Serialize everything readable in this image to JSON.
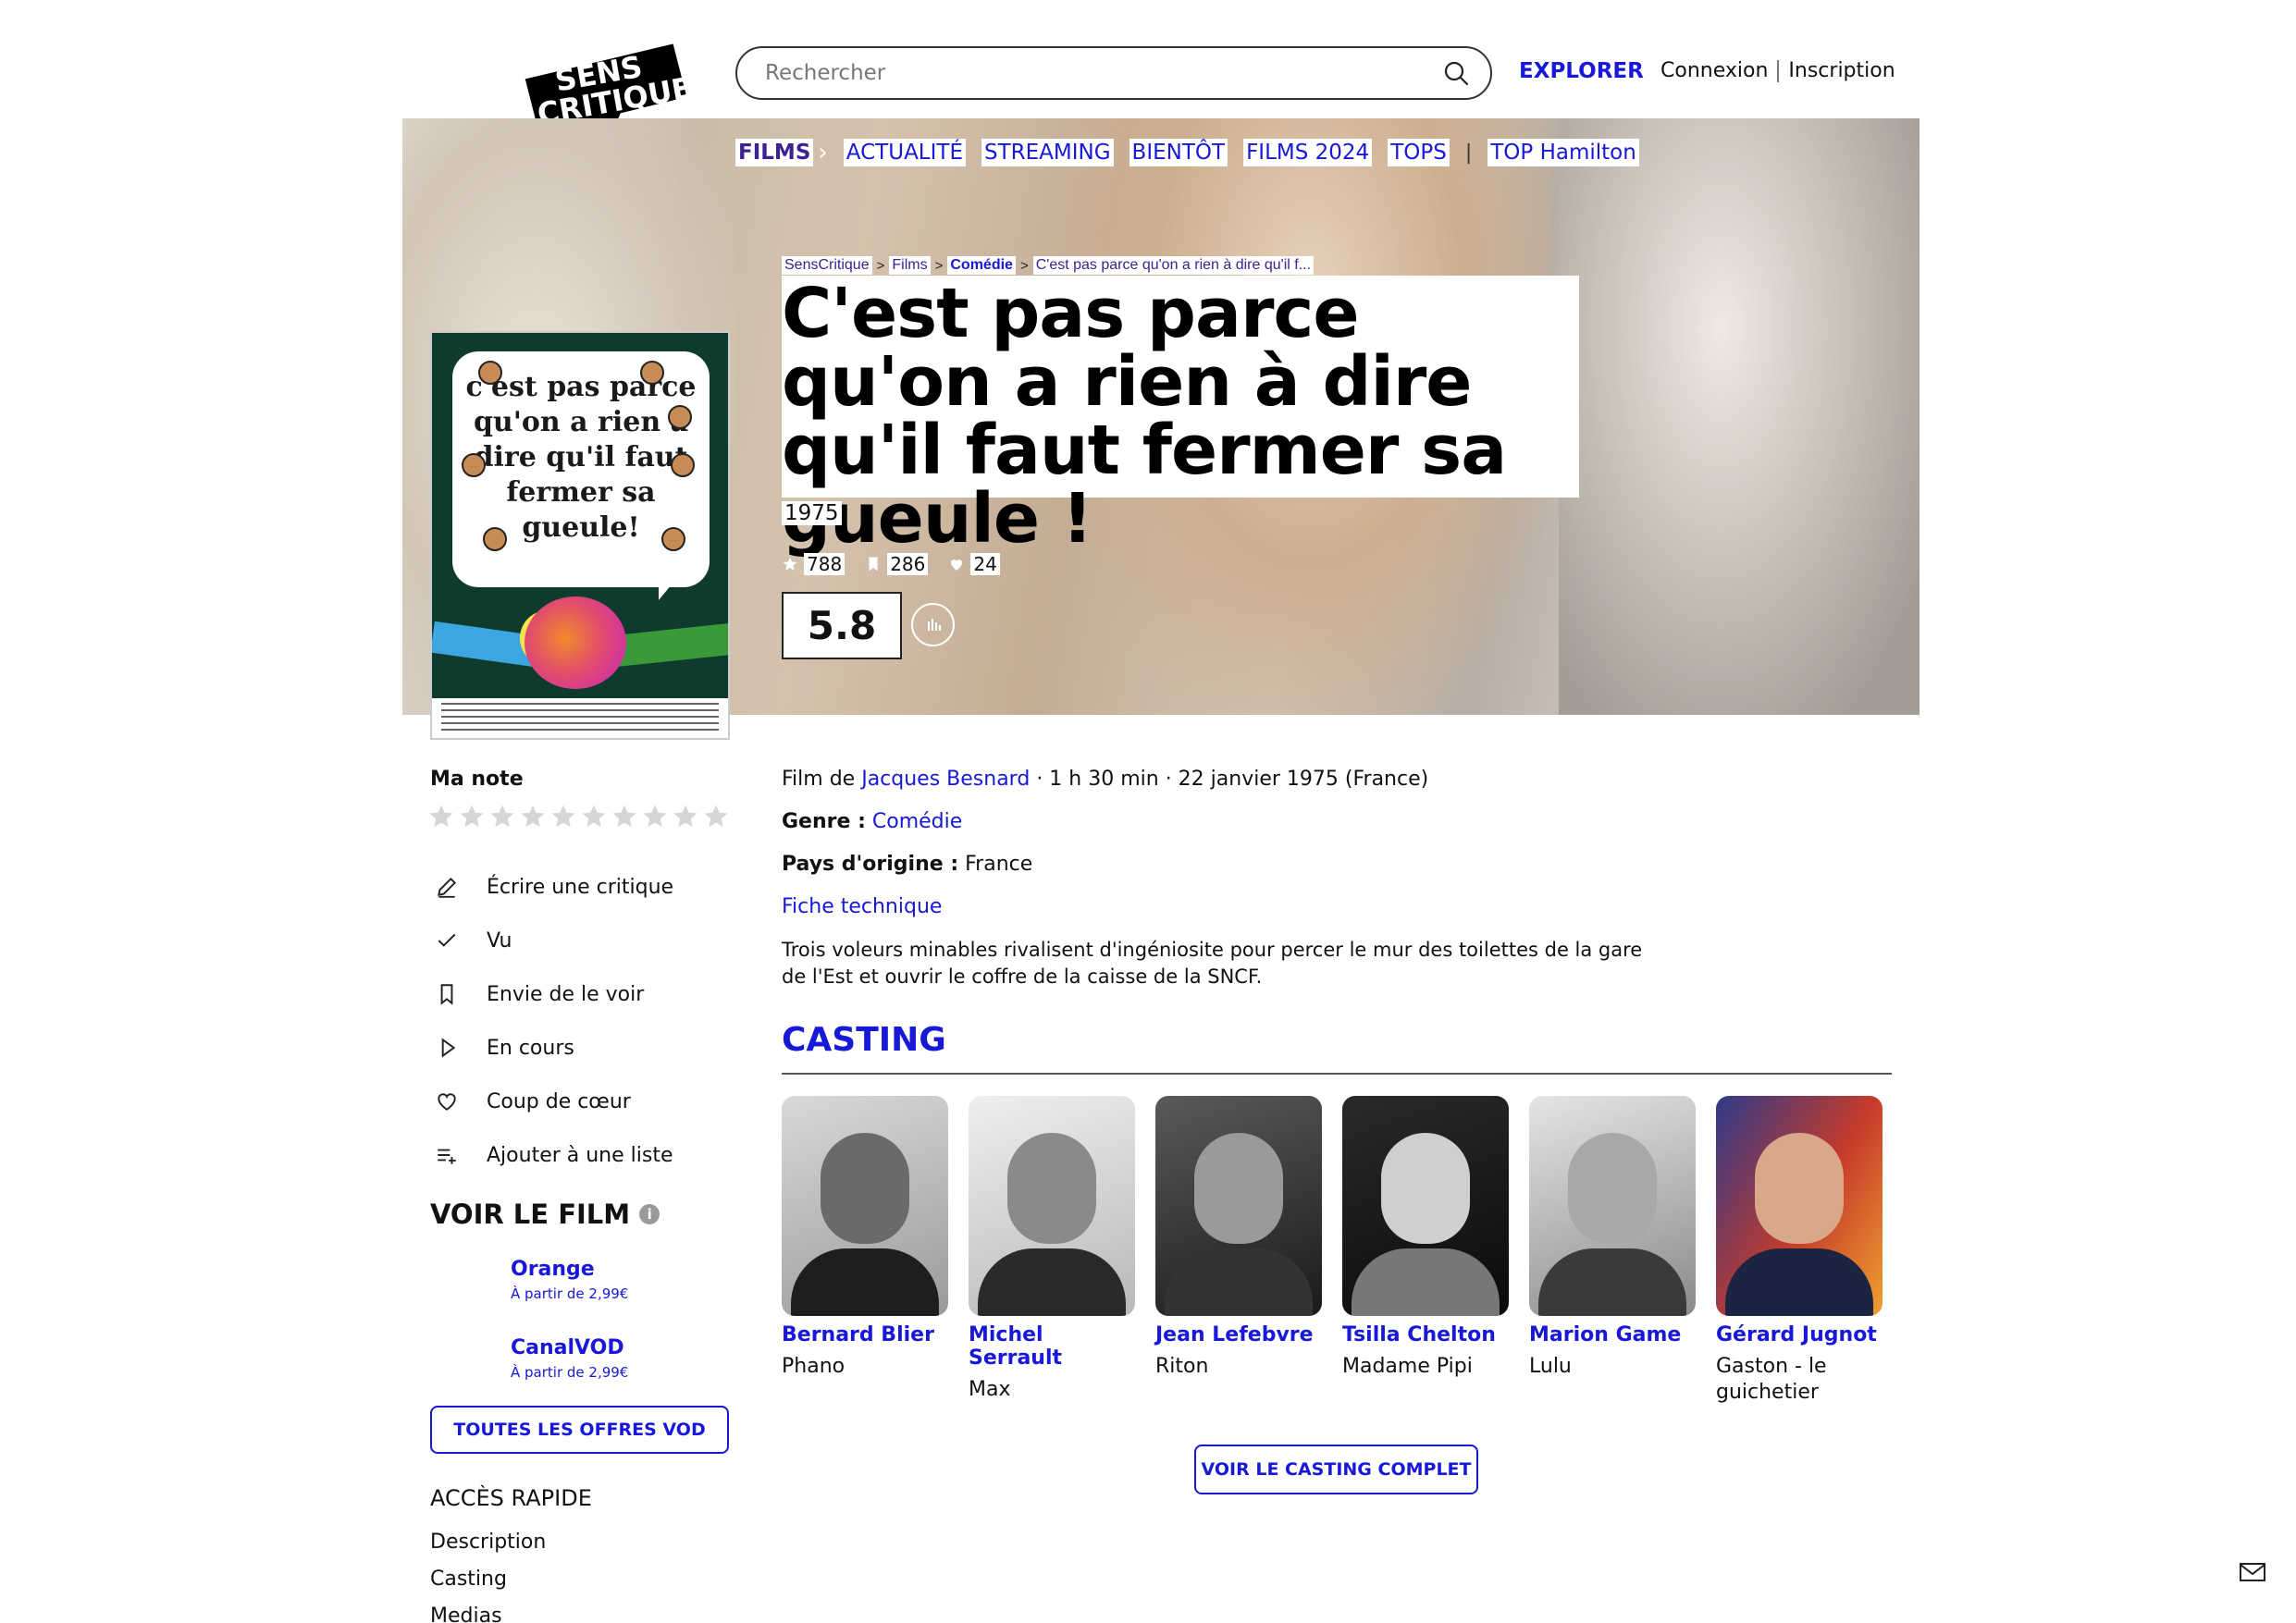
{
  "header": {
    "logo_text_line1": "SENS",
    "logo_text_line2": "CRITIQUE",
    "search_placeholder": "Rechercher",
    "explorer_label": "EXPLORER",
    "login_label": "Connexion",
    "signup_label": "Inscription"
  },
  "subnav": {
    "items": [
      "FILMS",
      "ACTUALITÉ",
      "STREAMING",
      "BIENTÔT",
      "FILMS 2024",
      "TOPS",
      "TOP Hamilton"
    ]
  },
  "breadcrumb": [
    "SensCritique",
    "Films",
    "Comédie",
    "C'est pas parce qu'on a rien à dire qu'il f..."
  ],
  "movie": {
    "title": "C'est pas parce qu'on a rien à dire qu'il faut fermer sa gueule !",
    "year": "1975",
    "ratings_count": "788",
    "wishlist_count": "286",
    "favorites_count": "24",
    "score": "5.8",
    "film_de_label": "Film de",
    "director": "Jacques Besnard",
    "details_rest": "· 1 h 30 min · 22 janvier 1975 (France)",
    "genre_label": "Genre :",
    "genre": "Comédie",
    "country_label": "Pays d'origine :",
    "country": "France",
    "fiche_technique": "Fiche technique",
    "synopsis": "Trois voleurs minables rivalisent d'ingéniosite pour percer le mur des toilettes de la gare de l'Est et ouvrir le coffre de la caisse de la SNCF."
  },
  "poster": {
    "text": "c'est pas parce qu'on a rien à dire qu'il faut fermer sa gueule!"
  },
  "sidebar": {
    "ma_note_label": "Ma note",
    "stars_count": 10,
    "actions": [
      {
        "label": "Écrire une critique",
        "icon": "pencil-icon"
      },
      {
        "label": "Vu",
        "icon": "check-icon"
      },
      {
        "label": "Envie de le voir",
        "icon": "bookmark-icon"
      },
      {
        "label": "En cours",
        "icon": "play-icon"
      },
      {
        "label": "Coup de cœur",
        "icon": "heart-icon"
      },
      {
        "label": "Ajouter à une liste",
        "icon": "list-add-icon"
      }
    ],
    "voir_le_film_title": "VOIR LE FILM",
    "vod": [
      {
        "name": "Orange",
        "price": "À partir de 2,99€"
      },
      {
        "name": "CanalVOD",
        "price": "À partir de 2,99€"
      }
    ],
    "vod_button": "TOUTES LES OFFRES VOD",
    "acces_title": "ACCÈS RAPIDE",
    "acces_items": [
      "Description",
      "Casting",
      "Medias"
    ]
  },
  "casting": {
    "title": "CASTING",
    "members": [
      {
        "name": "Bernard Blier",
        "role": "Phano"
      },
      {
        "name": "Michel Serrault",
        "role": "Max"
      },
      {
        "name": "Jean Lefebvre",
        "role": "Riton"
      },
      {
        "name": "Tsilla Chelton",
        "role": "Madame Pipi"
      },
      {
        "name": "Marion Game",
        "role": "Lulu"
      },
      {
        "name": "Gérard Jugnot",
        "role": "Gaston - le guichetier"
      }
    ],
    "full_button": "VOIR LE CASTING COMPLET"
  },
  "colors": {
    "accent_blue": "#1818d8",
    "films_purple": "#3d2190"
  },
  "footer": {
    "contact_icon": "mail-icon"
  }
}
